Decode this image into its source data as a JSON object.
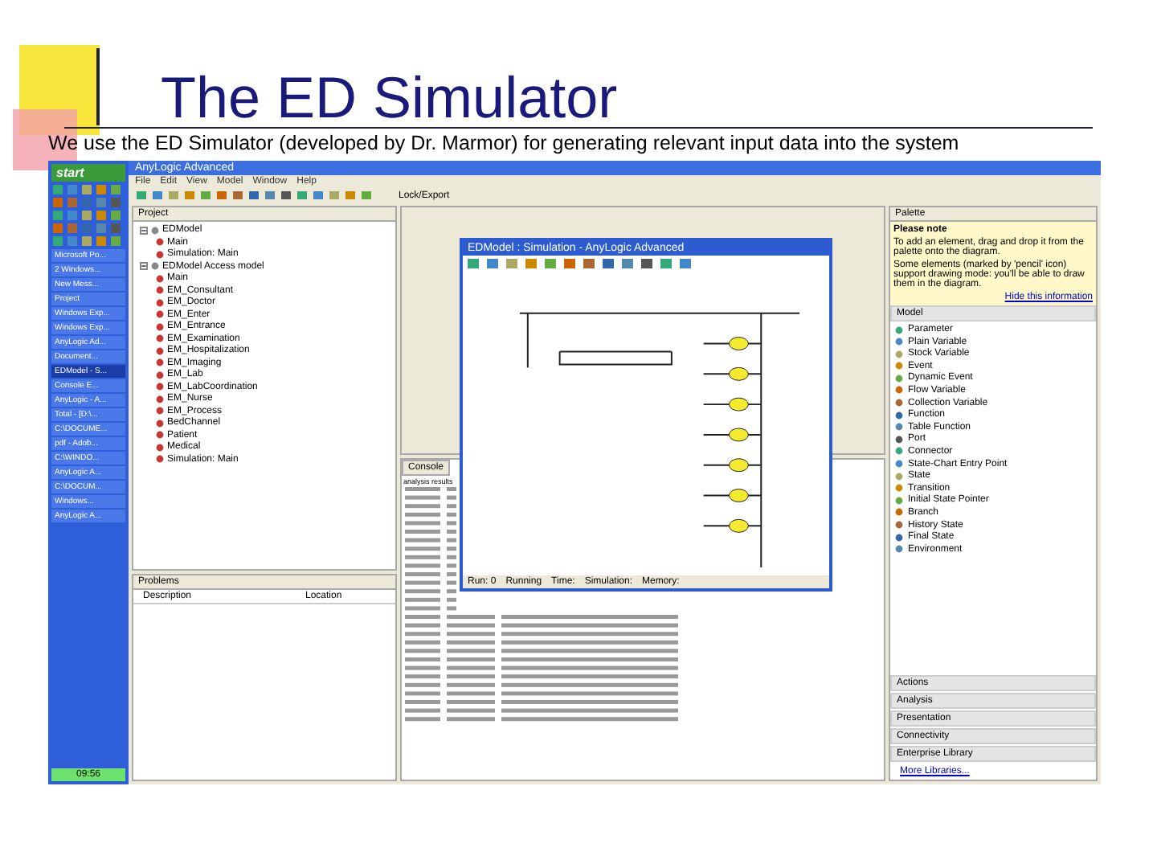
{
  "slide": {
    "title": "The ED Simulator",
    "subtitle": "We use the ED Simulator (developed by Dr. Marmor) for generating relevant input data into the system"
  },
  "taskbar": {
    "start": "start",
    "tasks": [
      {
        "label": "Microsoft Po...",
        "selected": false
      },
      {
        "label": "2 Windows...",
        "selected": false
      },
      {
        "label": "New Mess...",
        "selected": false
      },
      {
        "label": "Project",
        "selected": false
      },
      {
        "label": "Windows Exp...",
        "selected": false
      },
      {
        "label": "Windows Exp...",
        "selected": false
      },
      {
        "label": "AnyLogic Ad...",
        "selected": false
      },
      {
        "label": "Document...",
        "selected": false
      },
      {
        "label": "EDModel - S...",
        "selected": true
      },
      {
        "label": "Console E...",
        "selected": false
      },
      {
        "label": "AnyLogic - A...",
        "selected": false
      },
      {
        "label": "Total - [D:\\...",
        "selected": false
      },
      {
        "label": "C:\\DOCUME...",
        "selected": false
      },
      {
        "label": "pdf - Adob...",
        "selected": false
      },
      {
        "label": "C:\\WINDO...",
        "selected": false
      },
      {
        "label": "AnyLogic A...",
        "selected": false
      },
      {
        "label": "C:\\DOCUM...",
        "selected": false
      },
      {
        "label": "Windows...",
        "selected": false
      },
      {
        "label": "AnyLogic A...",
        "selected": false
      }
    ],
    "clock": "09:56"
  },
  "ide": {
    "title": "AnyLogic Advanced",
    "menu": [
      "File",
      "Edit",
      "View",
      "Model",
      "Window",
      "Help"
    ],
    "export": "Lock/Export",
    "project": {
      "tab": "Project",
      "tree": [
        {
          "label": "EDModel",
          "expanded": true,
          "children": [
            {
              "label": "Main"
            },
            {
              "label": "Simulation: Main"
            }
          ]
        },
        {
          "label": "EDModel Access model",
          "expanded": true,
          "children": [
            {
              "label": "Main"
            },
            {
              "label": "EM_Consultant"
            },
            {
              "label": "EM_Doctor"
            },
            {
              "label": "EM_Enter"
            },
            {
              "label": "EM_Entrance"
            },
            {
              "label": "EM_Examination"
            },
            {
              "label": "EM_Hospitalization"
            },
            {
              "label": "EM_Imaging"
            },
            {
              "label": "EM_Lab"
            },
            {
              "label": "EM_LabCoordination"
            },
            {
              "label": "EM_Nurse"
            },
            {
              "label": "EM_Process"
            },
            {
              "label": "BedChannel"
            },
            {
              "label": "Patient"
            },
            {
              "label": "Medical"
            },
            {
              "label": "Simulation: Main"
            }
          ]
        }
      ]
    },
    "problems": {
      "tab": "Problems",
      "columns": [
        "Description",
        "Location"
      ]
    },
    "console": {
      "tab": "Console",
      "header": "analysis results"
    },
    "palette": {
      "tab": "Palette",
      "note_title": "Please note",
      "note": "To add an element, drag and drop it from the palette onto the diagram.",
      "note_2": "Some elements (marked by 'pencil' icon) support drawing mode: you'll be able to draw them in the diagram.",
      "link": "Hide this information",
      "section": "Model",
      "items": [
        "Parameter",
        "Plain Variable",
        "Stock Variable",
        "Event",
        "Dynamic Event",
        "Flow Variable",
        "Collection Variable",
        "Function",
        "Table Function",
        "Port",
        "Connector",
        "State-Chart Entry Point",
        "State",
        "Transition",
        "Initial State Pointer",
        "Branch",
        "History State",
        "Final State",
        "Environment"
      ],
      "sections": [
        "Actions",
        "Analysis",
        "Presentation",
        "Connectivity",
        "Enterprise Library"
      ],
      "more": "More Libraries..."
    }
  },
  "simulation": {
    "title": "EDModel : Simulation - AnyLogic Advanced",
    "status": [
      "Run: 0",
      "Running",
      "Time:",
      "Simulation:",
      "Memory:"
    ]
  }
}
